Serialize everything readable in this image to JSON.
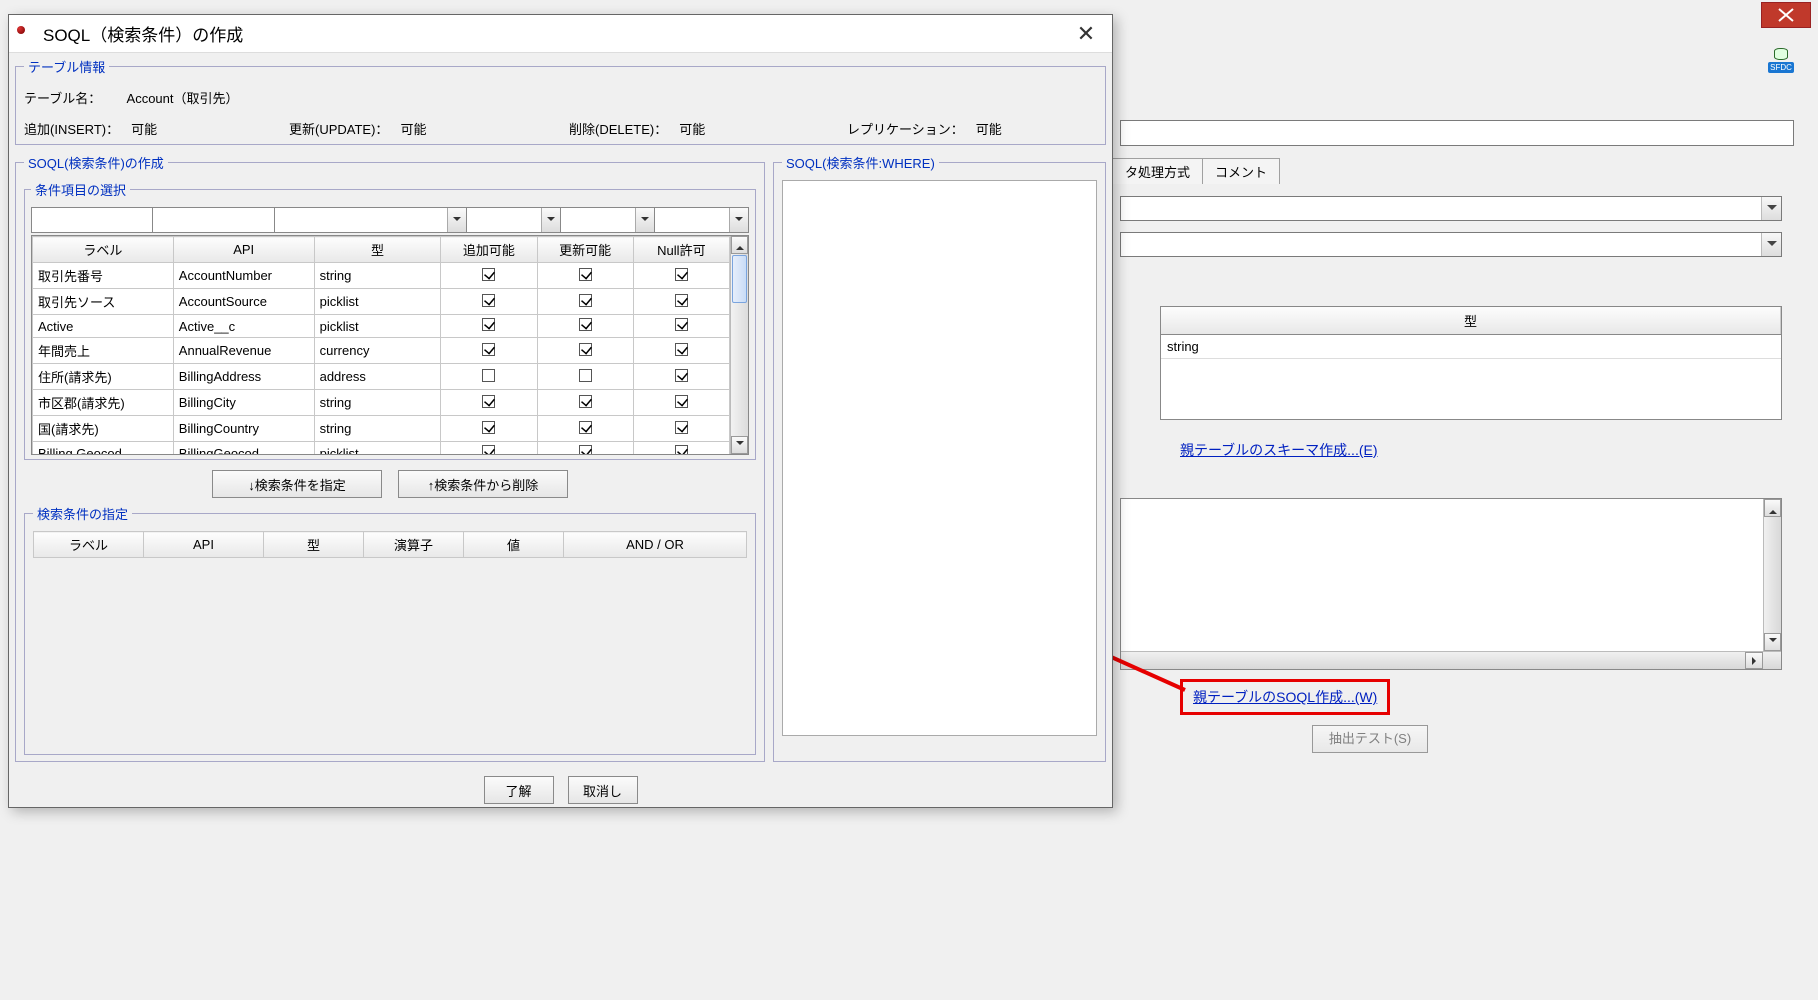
{
  "bg": {
    "tabs": {
      "data_method": "タ処理方式",
      "comment": "コメント"
    },
    "table": {
      "head_type": "型",
      "row_type": "string"
    },
    "link_schema": "親テーブルのスキーマ作成...(E)",
    "link_soql": "親テーブルのSOQL作成...(W)",
    "btn_test": "抽出テスト(S)",
    "sfdc_label": "SFDC"
  },
  "dialog": {
    "title": "SOQL（検索条件）の作成",
    "info": {
      "legend": "テーブル情報",
      "table_name_lbl": "テーブル名：",
      "table_name_val": "Account（取引先）",
      "insert_lbl": "追加(INSERT)：",
      "insert_val": "可能",
      "update_lbl": "更新(UPDATE)：",
      "update_val": "可能",
      "delete_lbl": "削除(DELETE)：",
      "delete_val": "可能",
      "repl_lbl": "レプリケーション：",
      "repl_val": "可能"
    },
    "create": {
      "legend": "SOQL(検索条件)の作成",
      "select_legend": "条件項目の選択",
      "columns": {
        "label": "ラベル",
        "api": "API",
        "type": "型",
        "addable": "追加可能",
        "updatable": "更新可能",
        "nullable": "Null許可"
      },
      "rows": [
        {
          "label": "取引先番号",
          "api": "AccountNumber",
          "type": "string",
          "add": true,
          "upd": true,
          "nul": true
        },
        {
          "label": "取引先ソース",
          "api": "AccountSource",
          "type": "picklist",
          "add": true,
          "upd": true,
          "nul": true
        },
        {
          "label": "Active",
          "api": "Active__c",
          "type": "picklist",
          "add": true,
          "upd": true,
          "nul": true
        },
        {
          "label": "年間売上",
          "api": "AnnualRevenue",
          "type": "currency",
          "add": true,
          "upd": true,
          "nul": true
        },
        {
          "label": "住所(請求先)",
          "api": "BillingAddress",
          "type": "address",
          "add": false,
          "upd": false,
          "nul": true
        },
        {
          "label": "市区郡(請求先)",
          "api": "BillingCity",
          "type": "string",
          "add": true,
          "upd": true,
          "nul": true
        },
        {
          "label": "国(請求先)",
          "api": "BillingCountry",
          "type": "string",
          "add": true,
          "upd": true,
          "nul": true
        },
        {
          "label": "Billing Geocod...",
          "api": "BillingGeocod...",
          "type": "picklist",
          "add": true,
          "upd": true,
          "nul": true
        }
      ],
      "btn_add": "↓検索条件を指定",
      "btn_remove": "↑検索条件から削除"
    },
    "spec": {
      "legend": "検索条件の指定",
      "columns": {
        "label": "ラベル",
        "api": "API",
        "type": "型",
        "op": "演算子",
        "value": "値",
        "andor": "AND / OR"
      }
    },
    "where": {
      "legend": "SOQL(検索条件:WHERE)"
    },
    "buttons": {
      "ok": "了解",
      "cancel": "取消し"
    }
  }
}
